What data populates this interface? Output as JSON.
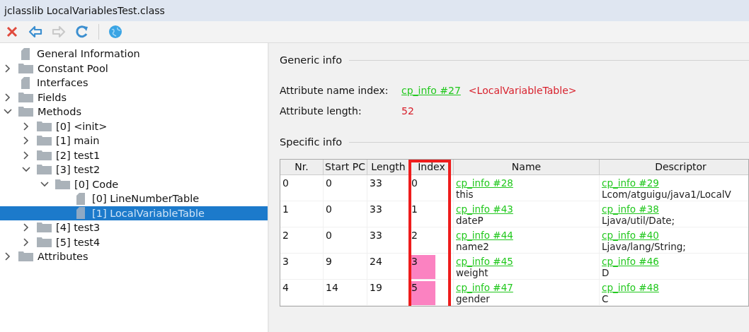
{
  "window": {
    "title": "jclasslib LocalVariablesTest.class"
  },
  "toolbar": [
    {
      "kind": "close",
      "disabled": false
    },
    {
      "kind": "back",
      "disabled": false
    },
    {
      "kind": "forward",
      "disabled": true
    },
    {
      "kind": "reload",
      "disabled": false
    },
    {
      "kind": "globe",
      "disabled": false
    }
  ],
  "tree": [
    {
      "label": "General Information",
      "kind": "file",
      "selected": false
    },
    {
      "label": "Constant Pool",
      "kind": "folder",
      "expanded": false,
      "selected": false
    },
    {
      "label": "Interfaces",
      "kind": "file",
      "selected": false
    },
    {
      "label": "Fields",
      "kind": "folder",
      "expanded": false,
      "selected": false
    },
    {
      "label": "Methods",
      "kind": "folder",
      "expanded": true,
      "selected": false,
      "children": [
        {
          "label": "[0] <init>",
          "kind": "folder",
          "expanded": false,
          "selected": false
        },
        {
          "label": "[1] main",
          "kind": "folder",
          "expanded": false,
          "selected": false
        },
        {
          "label": "[2] test1",
          "kind": "folder",
          "expanded": false,
          "selected": false
        },
        {
          "label": "[3] test2",
          "kind": "folder",
          "expanded": true,
          "selected": false,
          "children": [
            {
              "label": "[0] Code",
              "kind": "folder",
              "expanded": true,
              "selected": false,
              "children": [
                {
                  "label": "[0] LineNumberTable",
                  "kind": "file",
                  "selected": false
                },
                {
                  "label": "[1] LocalVariableTable",
                  "kind": "file",
                  "selected": true
                }
              ]
            }
          ]
        },
        {
          "label": "[4] test3",
          "kind": "folder",
          "expanded": false,
          "selected": false
        },
        {
          "label": "[5] test4",
          "kind": "folder",
          "expanded": false,
          "selected": false
        }
      ]
    },
    {
      "label": "Attributes",
      "kind": "folder",
      "expanded": false,
      "selected": false
    }
  ],
  "generic_info": {
    "title": "Generic info",
    "fields": [
      {
        "label": "Attribute name index:",
        "link": "cp_info #27",
        "value": "<LocalVariableTable>"
      },
      {
        "label": "Attribute length:",
        "value": "52"
      }
    ]
  },
  "specific_info": {
    "title": "Specific info",
    "table": {
      "columns": [
        {
          "label": "Nr.",
          "framed": false
        },
        {
          "label": "Start PC",
          "framed": false
        },
        {
          "label": "Length",
          "framed": false
        },
        {
          "label": "Index",
          "framed": true
        },
        {
          "label": "Name",
          "framed": false
        },
        {
          "label": "Descriptor",
          "framed": false
        }
      ],
      "rows": [
        {
          "nr": "0",
          "start_pc": "0",
          "length": "33",
          "index": "0",
          "index_highlighted": false,
          "name_link": "cp_info #28",
          "name": "this",
          "descriptor_link": "cp_info #29",
          "descriptor": "Lcom/atguigu/java1/LocalV"
        },
        {
          "nr": "1",
          "start_pc": "0",
          "length": "33",
          "index": "1",
          "index_highlighted": false,
          "name_link": "cp_info #43",
          "name": "dateP",
          "descriptor_link": "cp_info #38",
          "descriptor": "Ljava/util/Date;"
        },
        {
          "nr": "2",
          "start_pc": "0",
          "length": "33",
          "index": "2",
          "index_highlighted": false,
          "name_link": "cp_info #44",
          "name": "name2",
          "descriptor_link": "cp_info #40",
          "descriptor": "Ljava/lang/String;"
        },
        {
          "nr": "3",
          "start_pc": "9",
          "length": "24",
          "index": "3",
          "index_highlighted": true,
          "name_link": "cp_info #45",
          "name": "weight",
          "descriptor_link": "cp_info #46",
          "descriptor": "D"
        },
        {
          "nr": "4",
          "start_pc": "14",
          "length": "19",
          "index": "5",
          "index_highlighted": true,
          "name_link": "cp_info #47",
          "name": "gender",
          "descriptor_link": "cp_info #48",
          "descriptor": "C"
        }
      ]
    }
  }
}
